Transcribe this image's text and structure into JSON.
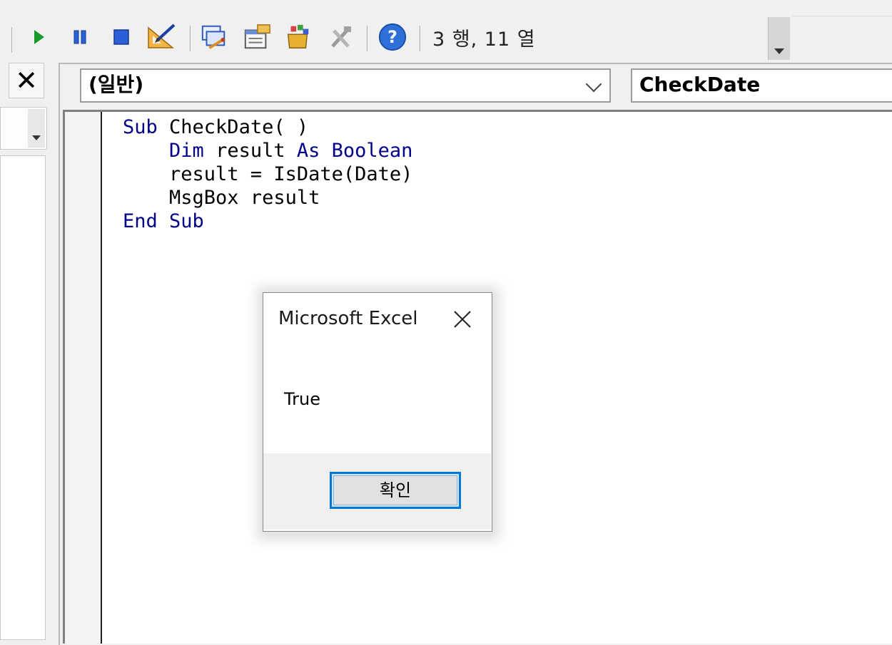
{
  "toolbar": {
    "buttons": [
      {
        "name": "run",
        "icon": "run-icon"
      },
      {
        "name": "break",
        "icon": "pause-icon"
      },
      {
        "name": "reset",
        "icon": "stop-icon"
      },
      {
        "name": "design-mode",
        "icon": "design-mode-icon"
      },
      {
        "name": "project-explorer",
        "icon": "project-explorer-icon"
      },
      {
        "name": "properties-window",
        "icon": "properties-icon"
      },
      {
        "name": "object-browser",
        "icon": "object-browser-icon"
      },
      {
        "name": "toolbox",
        "icon": "toolbox-icon"
      },
      {
        "name": "help",
        "icon": "help-icon"
      }
    ],
    "cursor_position": "3 행, 11 열"
  },
  "project_pane": {
    "close_glyph": "✕"
  },
  "code_window": {
    "object_combo_value": "(일반)",
    "procedure_combo_value": "CheckDate",
    "code_lines": [
      [
        {
          "t": "Sub ",
          "k": true
        },
        {
          "t": "CheckDate( )",
          "k": false
        }
      ],
      [
        {
          "t": "    ",
          "k": false
        },
        {
          "t": "Dim ",
          "k": true
        },
        {
          "t": "result ",
          "k": false
        },
        {
          "t": "As Boolean",
          "k": true
        }
      ],
      [
        {
          "t": "    result = IsDate(Date)",
          "k": false
        }
      ],
      [
        {
          "t": "    MsgBox result",
          "k": false
        }
      ],
      [
        {
          "t": "End Sub",
          "k": true
        }
      ]
    ]
  },
  "message_box": {
    "title": "Microsoft Excel",
    "message": "True",
    "ok_label": "확인"
  },
  "colors": {
    "keyword": "#00008b",
    "focus_border": "#0078d7"
  }
}
